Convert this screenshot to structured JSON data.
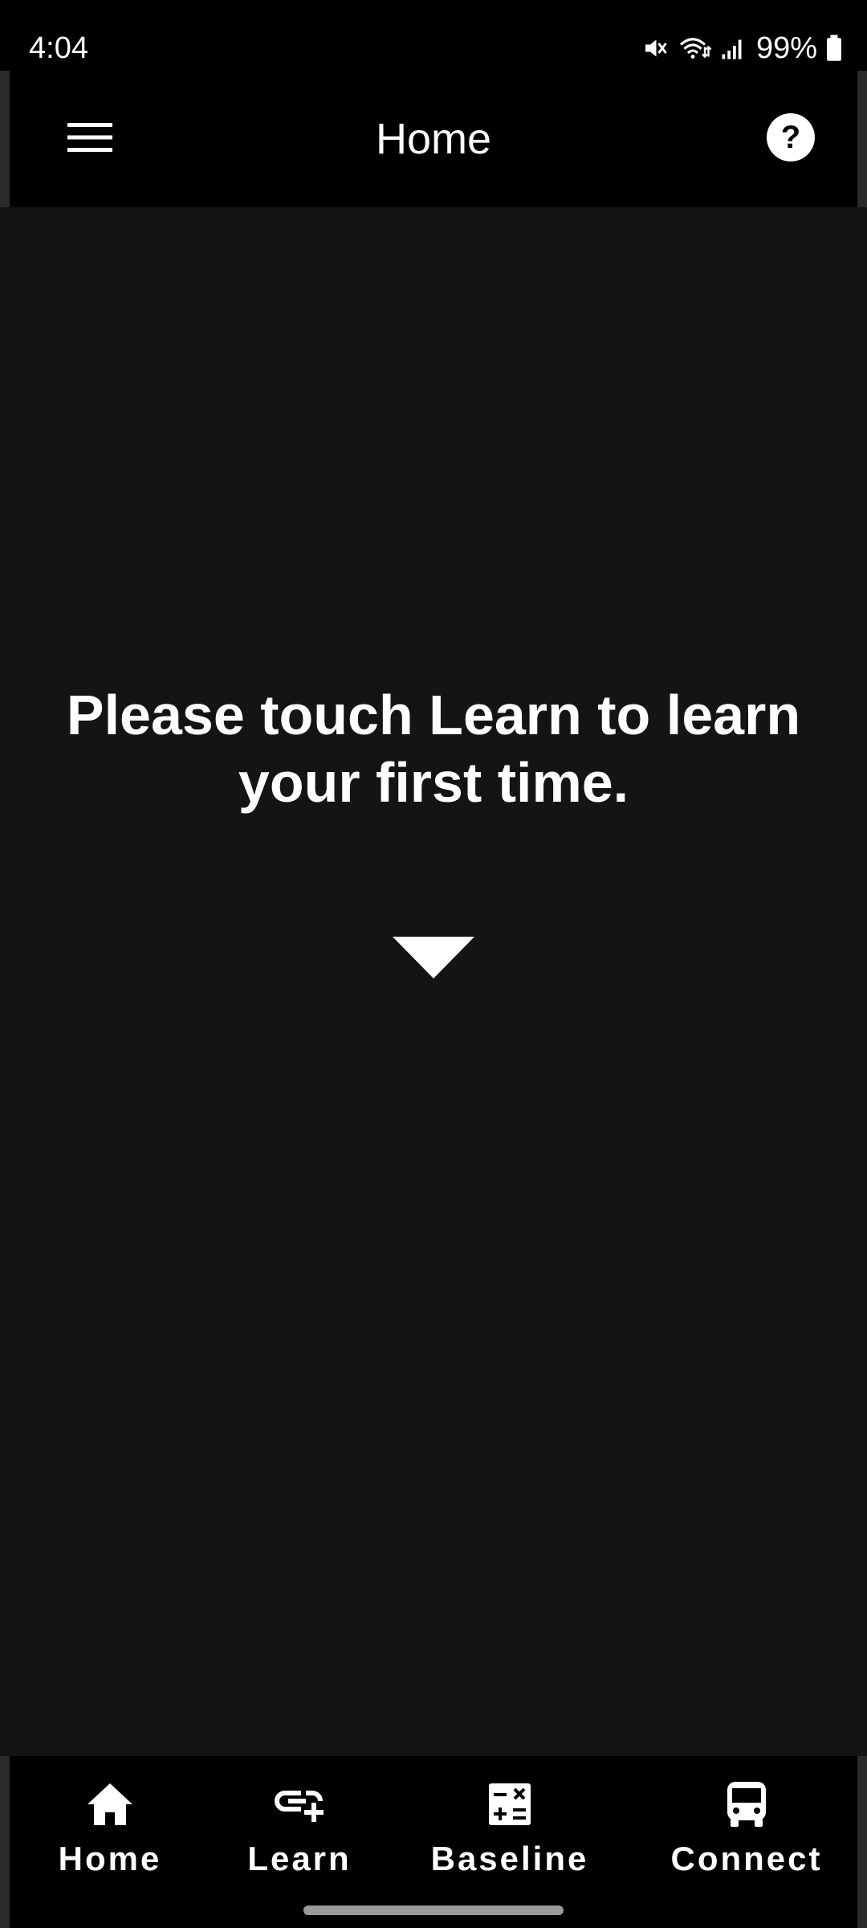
{
  "status_bar": {
    "time": "4:04",
    "battery_percent": "99%",
    "icons": [
      "mute-icon",
      "wifi-icon",
      "signal-icon",
      "battery-icon"
    ]
  },
  "app_bar": {
    "title": "Home",
    "menu_icon": "hamburger-menu-icon",
    "help_icon": "help-circle-icon"
  },
  "main": {
    "prompt": "Please touch Learn to learn your first time.",
    "arrow_icon": "triangle-down-icon"
  },
  "bottom_nav": {
    "items": [
      {
        "label": "Home",
        "icon": "home-icon"
      },
      {
        "label": "Learn",
        "icon": "link-add-icon"
      },
      {
        "label": "Baseline",
        "icon": "calculator-icon"
      },
      {
        "label": "Connect",
        "icon": "bus-icon"
      }
    ]
  },
  "colors": {
    "background": "#141414",
    "bars": "#000000",
    "text": "#ffffff",
    "gesture_bar": "#9a9a9a"
  }
}
